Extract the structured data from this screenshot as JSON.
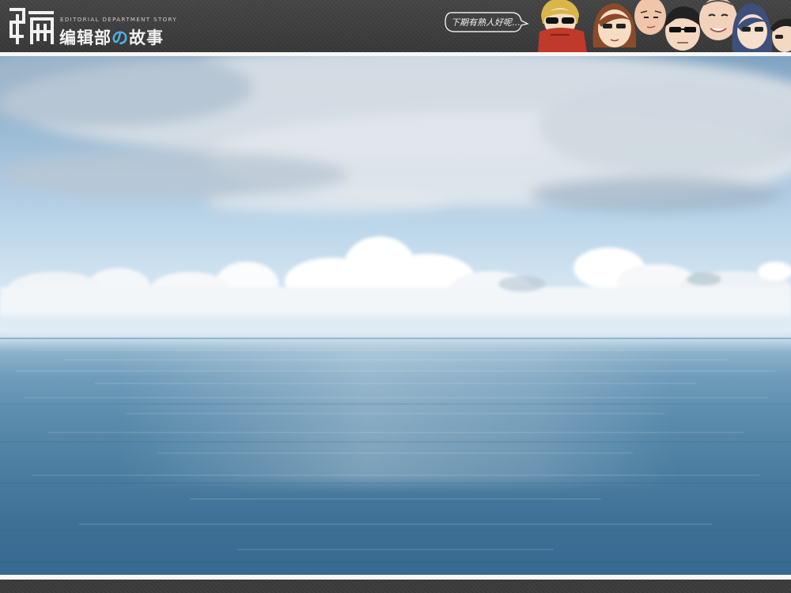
{
  "header": {
    "brand_subtitle": "EDITORIAL DEPARTMENT STORY",
    "brand_title_part1": "编辑部",
    "brand_title_accent": "の",
    "brand_title_part2": "故事",
    "logo_char": "编",
    "speech_bubble": "下期有熟人好呢..."
  },
  "characters": [
    {
      "name": "character-blond-sunglasses",
      "hair": "#d8b64a",
      "scarf": "#c0392b"
    },
    {
      "name": "character-brown-hair-glasses",
      "hair": "#8a4b2b"
    },
    {
      "name": "character-bald-man",
      "hair": "#f0c5a8"
    },
    {
      "name": "character-dark-hair-sunglasses",
      "hair": "#222222"
    },
    {
      "name": "character-chubby-man",
      "hair": "#f3d2bb"
    },
    {
      "name": "character-blue-hair-glasses",
      "hair": "#3d4f7a"
    },
    {
      "name": "character-edge-face",
      "hair": "#222222"
    }
  ],
  "colors": {
    "accent": "#4fb2e8",
    "header_bg": "#3f3f3f",
    "frame": "#f7f7f7"
  }
}
